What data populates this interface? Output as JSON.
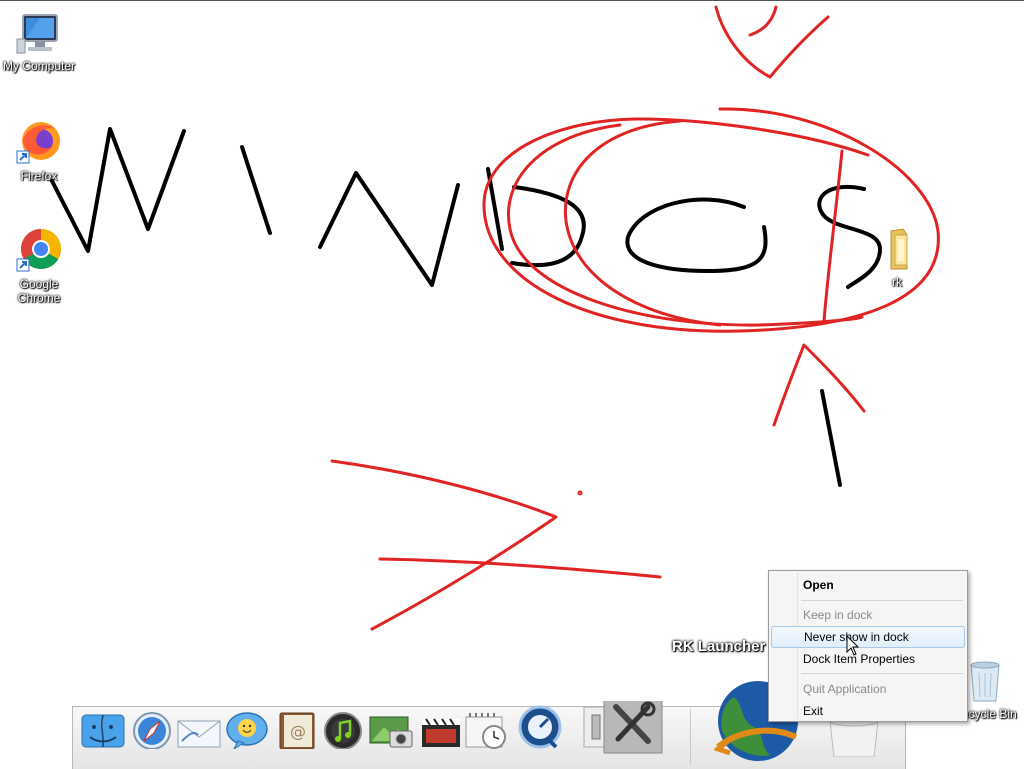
{
  "desktop": {
    "icons": [
      {
        "label": "My Computer",
        "icon": "computer-icon"
      },
      {
        "label": "Firefox",
        "icon": "firefox-icon"
      },
      {
        "label": "Google Chrome",
        "icon": "chrome-icon"
      },
      {
        "label": "rk",
        "icon": "folder-icon"
      },
      {
        "label": "Recycle Bin",
        "icon": "recycle-bin-icon"
      }
    ]
  },
  "annotation": {
    "handwritten_text": "WINDOS",
    "colors": {
      "ink": "#000000",
      "markup": "#e02424"
    }
  },
  "dock": {
    "tooltip": "RK Launcher",
    "items": [
      {
        "name": "finder",
        "icon": "finder-icon"
      },
      {
        "name": "safari",
        "icon": "safari-icon"
      },
      {
        "name": "mail",
        "icon": "mail-icon"
      },
      {
        "name": "ichat",
        "icon": "ichat-icon"
      },
      {
        "name": "address-book",
        "icon": "address-book-icon"
      },
      {
        "name": "itunes",
        "icon": "itunes-icon"
      },
      {
        "name": "iphoto",
        "icon": "iphoto-icon"
      },
      {
        "name": "imovie",
        "icon": "imovie-icon"
      },
      {
        "name": "ical",
        "icon": "ical-icon"
      },
      {
        "name": "quicktime",
        "icon": "quicktime-icon"
      },
      {
        "name": "tools",
        "icon": "tools-icon"
      },
      {
        "name": "rk-launcher",
        "icon": "globe-icon"
      },
      {
        "name": "trash",
        "icon": "trash-icon"
      }
    ]
  },
  "context_menu": {
    "items": [
      {
        "label": "Open",
        "state": "bold"
      },
      {
        "label": "Keep in dock",
        "state": "disabled"
      },
      {
        "label": "Never show in dock",
        "state": "highlighted"
      },
      {
        "label": "Dock Item Properties",
        "state": "normal"
      },
      {
        "label": "Quit Application",
        "state": "disabled"
      },
      {
        "label": "Exit",
        "state": "normal"
      }
    ]
  }
}
